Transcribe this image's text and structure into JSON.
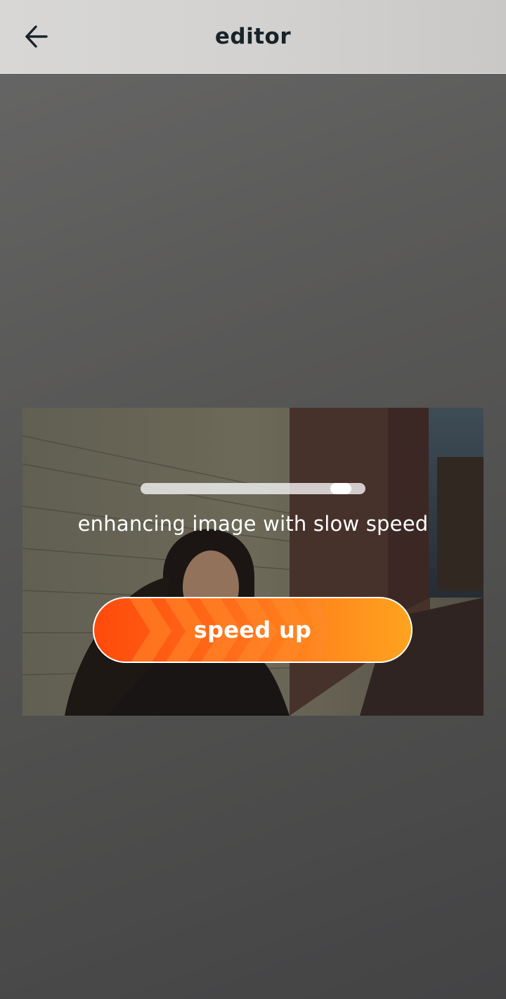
{
  "header": {
    "title": "editor",
    "back_icon": "arrow-left-icon"
  },
  "dialog": {
    "progress_fraction": 0.93,
    "status_text": "enhancing image with slow speed",
    "speed_up_label": "speed up"
  },
  "colors": {
    "button_start": "#ff4a0c",
    "button_end": "#ffa31f",
    "header_title": "#17232b"
  }
}
